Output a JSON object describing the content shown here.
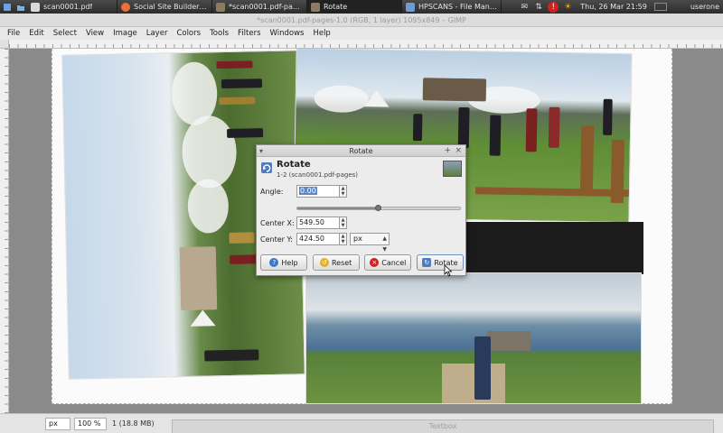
{
  "taskbar": {
    "tasks": [
      {
        "label": "scan0001.pdf",
        "icon": "document-icon",
        "color": "#d9d9d9"
      },
      {
        "label": "Social Site Builder - A...",
        "icon": "browser-icon",
        "color": "#e8703a"
      },
      {
        "label": "*scan0001.pdf-pages-...",
        "icon": "gimp-icon",
        "color": "#8b7b63"
      },
      {
        "label": "Rotate",
        "icon": "gimp-icon",
        "color": "#8b7b63"
      },
      {
        "label": "HPSCANS - File Mana...",
        "icon": "folder-icon",
        "color": "#6f9bd1"
      }
    ],
    "clock": "Thu, 26 Mar  21:59",
    "user": "userone"
  },
  "window": {
    "title": "*scan0001.pdf-pages-1.0 (RGB, 1 layer) 1095x849 – GIMP"
  },
  "menu": [
    "File",
    "Edit",
    "Select",
    "View",
    "Image",
    "Layer",
    "Colors",
    "Tools",
    "Filters",
    "Windows",
    "Help"
  ],
  "statusbar": {
    "unit": "px",
    "zoom": "100 %",
    "info": "1 (18.8 MB)",
    "textbox_dock": "Textbox"
  },
  "dialog": {
    "title": "Rotate",
    "heading": "Rotate",
    "subheading": "1-2 (scan0001.pdf-pages)",
    "angle_label": "Angle:",
    "angle_value": "0.00",
    "angle_slider_fraction": 0.5,
    "center_x_label": "Center X:",
    "center_x_value": "549.50",
    "center_y_label": "Center Y:",
    "center_y_value": "424.50",
    "unit": "px",
    "buttons": {
      "help": "Help",
      "reset": "Reset",
      "cancel": "Cancel",
      "rotate": "Rotate"
    }
  }
}
